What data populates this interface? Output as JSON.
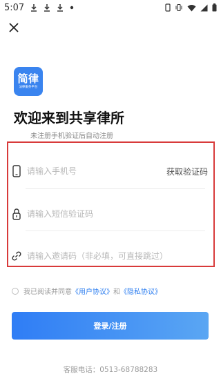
{
  "status_bar": {
    "time": "5:07",
    "icons_left": [
      "download-icon",
      "download-icon",
      "pen-download-icon",
      "dot-icon"
    ],
    "icons_right": [
      "battery-outline-icon",
      "vibrate-icon",
      "wifi-icon",
      "signal-icon",
      "battery-icon"
    ]
  },
  "header": {
    "close_icon": "close-icon"
  },
  "logo": {
    "main": "简律",
    "sub": "法律服务平台"
  },
  "title": "欢迎来到共享律所",
  "subtitle": "未注册手机验证后自动注册",
  "form": {
    "phone": {
      "placeholder": "请输入手机号",
      "value": "",
      "icon": "phone-icon"
    },
    "get_code_label": "获取验证码",
    "sms_code": {
      "placeholder": "请输入短信验证码",
      "value": "",
      "icon": "lock-icon"
    },
    "invite_code": {
      "placeholder": "请输入邀请码（非必填，可直接跳过）",
      "value": "",
      "icon": "link-icon"
    }
  },
  "agreement": {
    "prefix": "我已阅读并同意",
    "user_agreement": "《用户协议》",
    "and": "和",
    "privacy_agreement": "《隐私协议》"
  },
  "submit_label": "登录/注册",
  "service_phone": "客服电话：0513-68788283",
  "colors": {
    "accent": "#2f7ff0",
    "highlight_border": "#d83a3a",
    "logo_bg": "#3a84ef"
  }
}
